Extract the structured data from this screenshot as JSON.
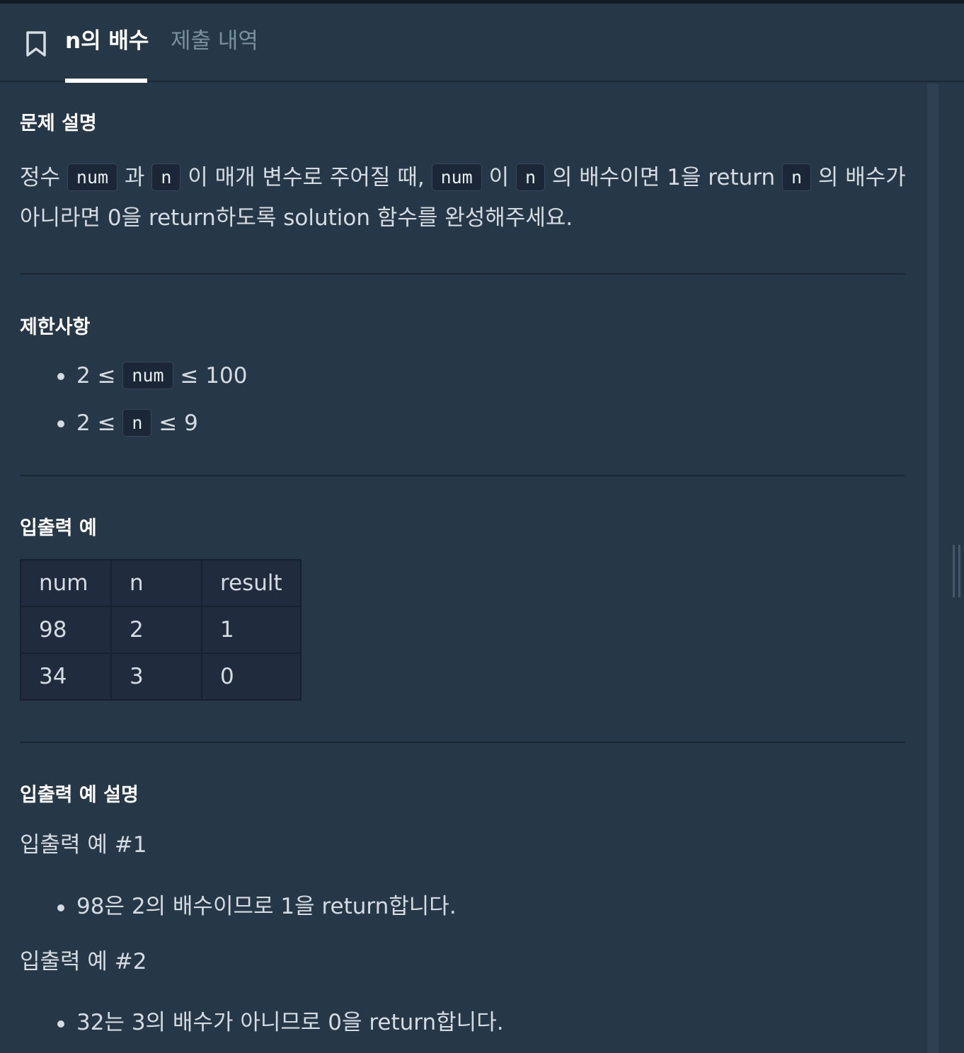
{
  "header": {
    "tabs": [
      {
        "label": "n의 배수",
        "active": true
      },
      {
        "label": "제출 내역",
        "active": false
      }
    ]
  },
  "description": {
    "title": "문제 설명",
    "line1": {
      "t1": "정수",
      "c1": "num",
      "t2": "과",
      "c2": "n",
      "t3": "이 매개 변수로 주어질 때,",
      "c3": "num",
      "t4": "이",
      "c4": "n",
      "t5": "의 배수이면 1을 return",
      "c5": "n",
      "t6": "의 배수가"
    },
    "line2": "아니라면 0을 return하도록 solution 함수를 완성해주세요."
  },
  "constraints": {
    "title": "제한사항",
    "items": [
      {
        "pre": "2 ≤",
        "code": "num",
        "post": "≤ 100"
      },
      {
        "pre": "2 ≤",
        "code": "n",
        "post": "≤ 9"
      }
    ]
  },
  "examples": {
    "title": "입출력 예",
    "headers": [
      "num",
      "n",
      "result"
    ],
    "rows": [
      [
        "98",
        "2",
        "1"
      ],
      [
        "34",
        "3",
        "0"
      ]
    ]
  },
  "explanation": {
    "title": "입출력 예 설명",
    "cases": [
      {
        "label": "입출력 예 #1",
        "text": "98은 2의 배수이므로 1을 return합니다."
      },
      {
        "label": "입출력 예 #2",
        "text": "32는 3의 배수가 아니므로 0을 return합니다."
      }
    ]
  }
}
